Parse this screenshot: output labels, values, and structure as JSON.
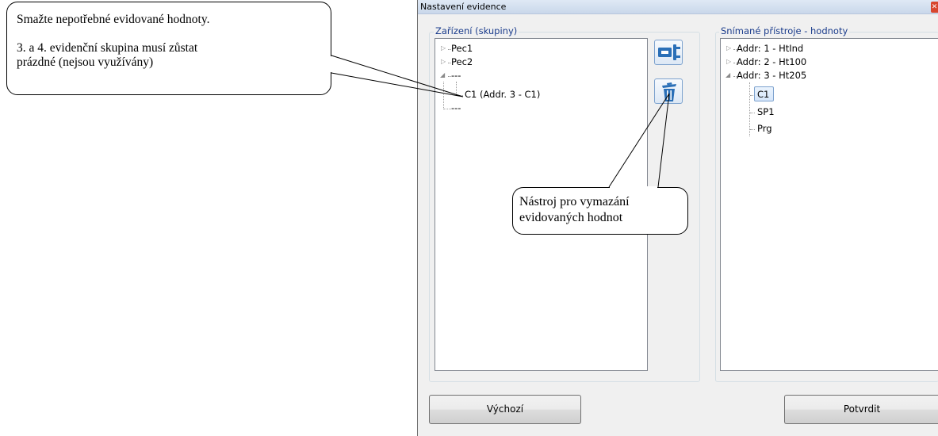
{
  "callouts": {
    "top_line1": "Smažte nepotřebné evidované hodnoty.",
    "top_line2": "3. a 4. evidenční skupina musí zůstat",
    "top_line3": "prázdné (nejsou využívány)",
    "bottom_line1": "Nástroj pro vymazání",
    "bottom_line2": "evidovaných hodnot"
  },
  "dialog": {
    "title": "Nastavení evidence",
    "close_glyph": "✕"
  },
  "left_group": {
    "label": "Zařízení (skupiny)",
    "items": [
      {
        "label": "Pec1"
      },
      {
        "label": "Pec2"
      },
      {
        "label": "---"
      },
      {
        "label": "C1 (Addr. 3 - C1)"
      },
      {
        "label": "---"
      }
    ]
  },
  "right_group": {
    "label": "Snímané přístroje - hodnoty",
    "items": [
      {
        "label": "Addr: 1 - HtInd"
      },
      {
        "label": "Addr: 2 - Ht100"
      },
      {
        "label": "Addr: 3 - Ht205"
      },
      {
        "label": "C1"
      },
      {
        "label": "SP1"
      },
      {
        "label": "Prg"
      }
    ]
  },
  "tools": {
    "add_icon": "assign-icon",
    "delete_icon": "trash-icon"
  },
  "buttons": {
    "default_label": "Výchozí",
    "confirm_label": "Potvrdit"
  },
  "colors": {
    "group_label": "#1a3c8c",
    "selection_border": "#7da2ce",
    "icon_blue": "#2a6fb7"
  }
}
